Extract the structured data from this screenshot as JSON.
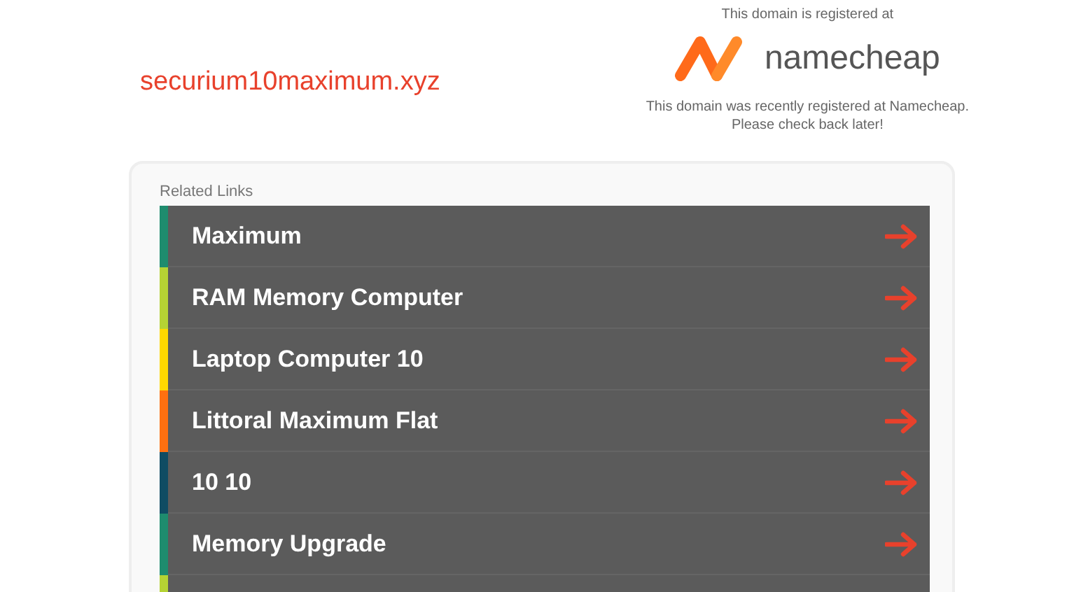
{
  "domain": "securium10maximum.xyz",
  "registrar": {
    "intro": "This domain is registered at",
    "logo_text": "namecheap",
    "note_lines": [
      "This domain was recently registered at Namecheap.",
      "Please check back later!"
    ]
  },
  "related": {
    "title": "Related Links",
    "links": [
      {
        "label": "Maximum",
        "color": "#1e8c6e"
      },
      {
        "label": "RAM Memory Computer",
        "color": "#b5d334"
      },
      {
        "label": "Laptop Computer 10",
        "color": "#ffd800"
      },
      {
        "label": "Littoral Maximum Flat",
        "color": "#ff7010"
      },
      {
        "label": "10 10",
        "color": "#0f4c63"
      },
      {
        "label": "Memory Upgrade",
        "color": "#1e8c6e"
      },
      {
        "color": "#b5d334"
      }
    ]
  }
}
